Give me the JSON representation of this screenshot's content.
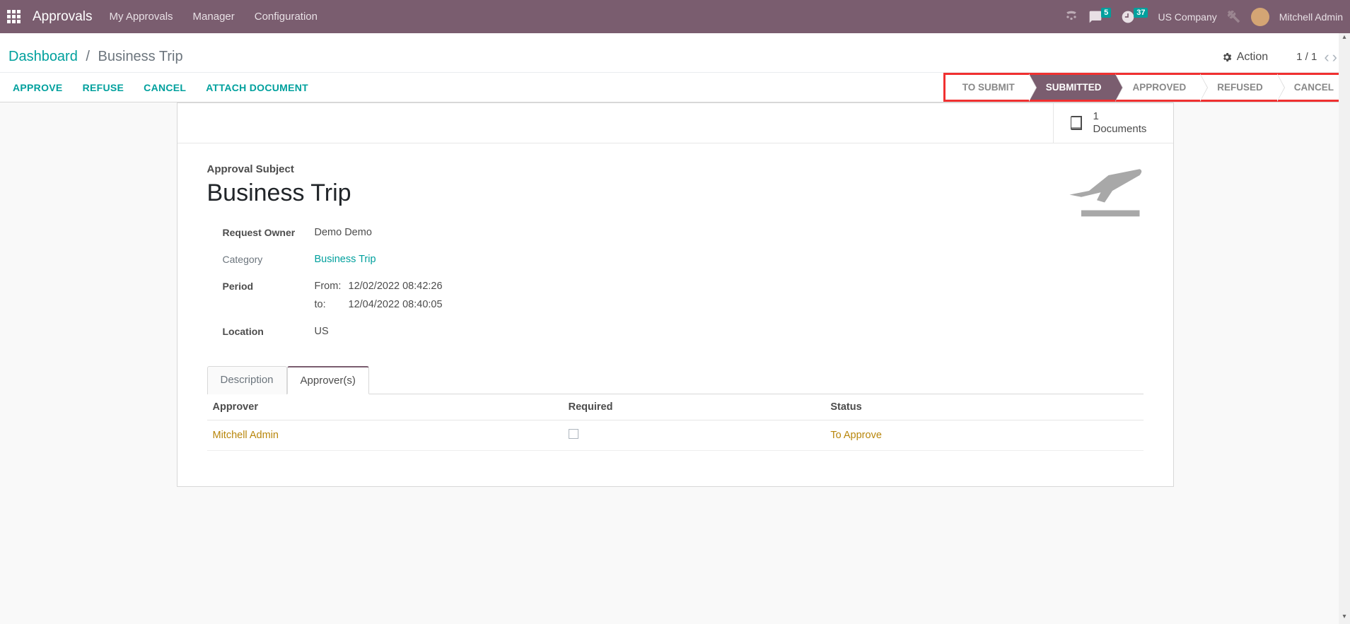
{
  "navbar": {
    "app_title": "Approvals",
    "menu": [
      {
        "label": "My Approvals"
      },
      {
        "label": "Manager"
      },
      {
        "label": "Configuration"
      }
    ],
    "messages_badge": "5",
    "activities_badge": "37",
    "company": "US Company",
    "username": "Mitchell Admin"
  },
  "breadcrumb": {
    "root": "Dashboard",
    "current": "Business Trip"
  },
  "control": {
    "action_label": "Action",
    "pager": "1 / 1"
  },
  "toolbar": {
    "approve": "APPROVE",
    "refuse": "REFUSE",
    "cancel": "CANCEL",
    "attach": "ATTACH DOCUMENT"
  },
  "status_steps": [
    {
      "label": "TO SUBMIT",
      "active": false
    },
    {
      "label": "SUBMITTED",
      "active": true
    },
    {
      "label": "APPROVED",
      "active": false
    },
    {
      "label": "REFUSED",
      "active": false
    },
    {
      "label": "CANCEL",
      "active": false
    }
  ],
  "documents_button": {
    "count": "1",
    "label": "Documents"
  },
  "form": {
    "subject_label": "Approval Subject",
    "subject_value": "Business Trip",
    "fields": {
      "request_owner_label": "Request Owner",
      "request_owner_value": "Demo Demo",
      "category_label": "Category",
      "category_value": "Business Trip",
      "period_label": "Period",
      "period_from_label": "From:",
      "period_from_value": "12/02/2022 08:42:26",
      "period_to_label": "to:",
      "period_to_value": "12/04/2022 08:40:05",
      "location_label": "Location",
      "location_value": "US"
    }
  },
  "tabs": {
    "description": "Description",
    "approvers": "Approver(s)"
  },
  "approvers_table": {
    "headers": {
      "approver": "Approver",
      "required": "Required",
      "status": "Status"
    },
    "rows": [
      {
        "approver": "Mitchell Admin",
        "required": false,
        "status": "To Approve"
      }
    ]
  }
}
